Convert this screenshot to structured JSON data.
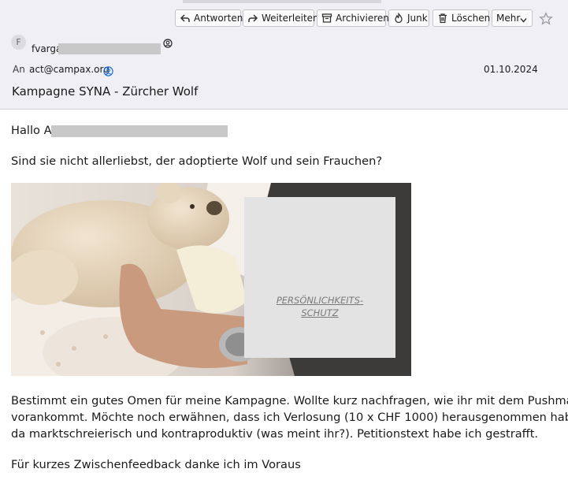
{
  "toolbar": {
    "reply_label": "Antworten",
    "forward_label": "Weiterleiten",
    "archive_label": "Archivieren",
    "junk_label": "Junk",
    "delete_label": "Löschen",
    "more_label": "Mehr"
  },
  "header": {
    "avatar_letter": "F",
    "from_visible": "fvarga",
    "to_label": "An",
    "to_address": "act@campax.org",
    "date": "01.10.2024",
    "subject": "Kampagne SYNA - Zürcher Wolf"
  },
  "body": {
    "greeting": "Hallo A",
    "question": "Sind sie nicht allerliebst, der adoptierte Wolf und sein Frauchen?",
    "paragraph_lines": [
      "Bestimmt ein gutes Omen für meine Kampagne. Wollte kurz nachfragen, wie ihr mit dem Pushmail",
      "vorankommt. Möchte noch erwähnen, dass ich Verlosung (10 x CHF 1000) herausgenommen habe,",
      "da marktschreierisch und kontraproduktiv (was meint ihr?). Petitionstext habe ich gestrafft."
    ],
    "closing": "Für kurzes Zwischenfeedback danke ich im Voraus",
    "placeholder_lines": [
      "PERSÖNLICHKEITS-",
      "SCHUTZ"
    ]
  },
  "colors": {
    "header_bg": "#f0f0f4",
    "button_border": "#c4c4c9",
    "redaction": "#c8c8c8",
    "address_icon": "#1a6dd8"
  }
}
